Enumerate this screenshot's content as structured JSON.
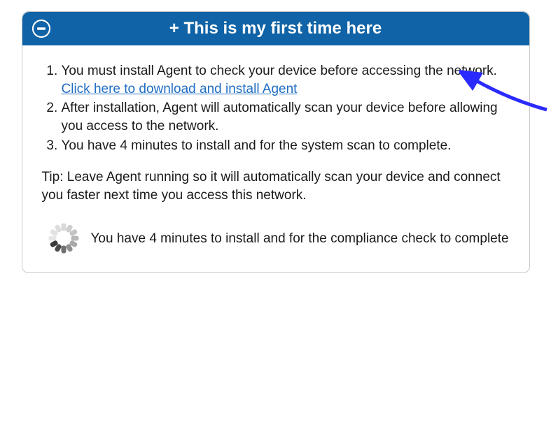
{
  "header": {
    "title": "+ This is my first time here"
  },
  "steps": {
    "item1_prefix": "You must install Agent to check your device before accessing the network. ",
    "item1_link": "Click here to download and install Agent",
    "item2": "After installation, Agent will automatically scan your device before allowing you access to the network.",
    "item3": "You have 4 minutes to install and for the system scan to complete."
  },
  "tip": "Tip: Leave Agent running so it will automatically scan your device and connect you faster next time you access this network.",
  "status": "You have 4 minutes to install and for the compliance check to complete",
  "colors": {
    "headerBg": "#0f63a6",
    "link": "#1f6dc4",
    "arrow": "#2a2aff"
  }
}
